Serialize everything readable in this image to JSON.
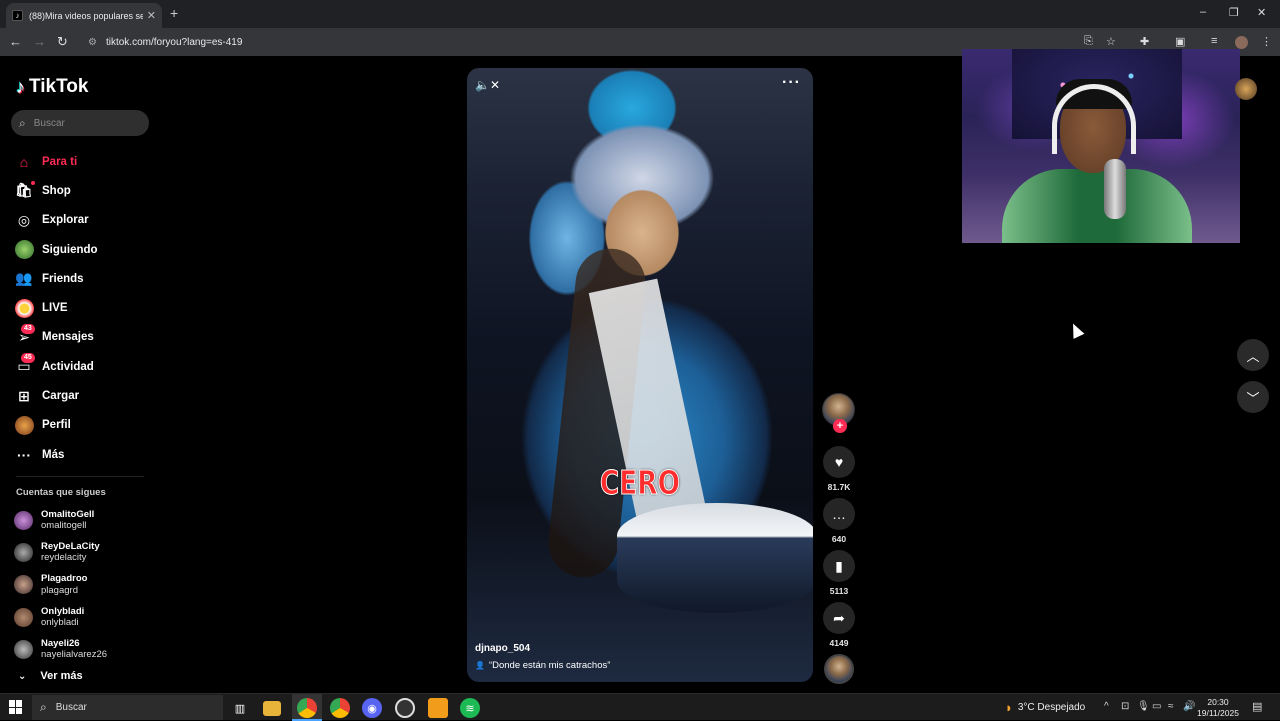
{
  "browser": {
    "tab_title": "(88)Mira videos populares sele",
    "new_tab": "+",
    "url": "tiktok.com/foryou?lang=es-419"
  },
  "app": {
    "logo": "TikTok",
    "search_placeholder": "Buscar",
    "nav": [
      {
        "label": "Para ti",
        "icon": "home-icon",
        "active": true
      },
      {
        "label": "Shop",
        "icon": "shop-icon"
      },
      {
        "label": "Explorar",
        "icon": "compass-icon"
      },
      {
        "label": "Siguiendo",
        "icon": "following-avatar-icon"
      },
      {
        "label": "Friends",
        "icon": "friends-icon"
      },
      {
        "label": "LIVE",
        "icon": "live-icon"
      },
      {
        "label": "Mensajes",
        "icon": "send-icon",
        "badge": "43"
      },
      {
        "label": "Actividad",
        "icon": "inbox-icon",
        "badge": "45"
      },
      {
        "label": "Cargar",
        "icon": "upload-icon"
      },
      {
        "label": "Perfil",
        "icon": "profile-avatar-icon"
      },
      {
        "label": "Más",
        "icon": "more-icon"
      }
    ],
    "following_title": "Cuentas que sigues",
    "following": [
      {
        "name": "OmalitoGell",
        "handle": "omalitogell",
        "color": "#6a4a8a"
      },
      {
        "name": "ReyDeLaCity",
        "handle": "reydelacity",
        "color": "#222222"
      },
      {
        "name": "Plagadrоо",
        "handle": "plagagrd",
        "color": "#3a2a2a"
      },
      {
        "name": "Onlybladi",
        "handle": "onlybladi",
        "color": "#7a5a4a"
      },
      {
        "name": "Nayeli26",
        "handle": "nayelialvarez26",
        "color": "#3a3a3a"
      }
    ],
    "see_more": "Ver más"
  },
  "video": {
    "overlay_text": "CERO",
    "author": "djnapo_504",
    "description": "“Donde están mis catrachos”",
    "likes": "81.7K",
    "comments": "640",
    "saves": "5113",
    "shares": "4149"
  },
  "taskbar": {
    "search": "Buscar",
    "weather": "3°C  Despejado",
    "time": "20:30",
    "date": "19/11/2025"
  },
  "colors": {
    "accent": "#fe2c55",
    "background": "#000000"
  }
}
